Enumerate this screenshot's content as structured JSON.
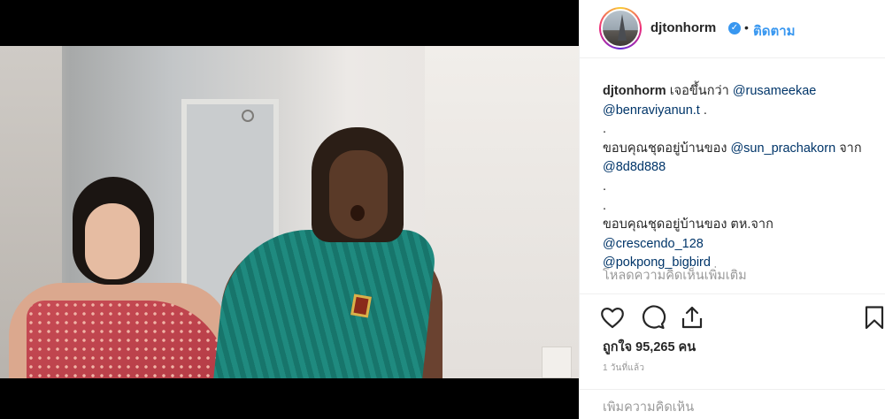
{
  "post": {
    "username": "djtonhorm",
    "verified_icon": "verified-badge-icon",
    "separator": "•",
    "follow_label": "ติดตาม",
    "caption": {
      "author": "djtonhorm",
      "intro": "เจอขึ้นกว่า",
      "mention_1": "@rusameekae",
      "mention_2": "@benraviyanun.t",
      "mention_2_trail": " .",
      "dot_1": ".",
      "thanks_1": "ขอบคุณชุดอยู่บ้านของ",
      "mention_3": "@sun_prachakorn",
      "from_1": "จาก",
      "mention_4": "@8d8d888",
      "dot_2": ".",
      "dot_3": ".",
      "thanks_2": "ขอบคุณชุดอยู่บ้านของ ตห.จาก",
      "mention_5": "@crescendo_128",
      "mention_6": "@pokpong_bigbird"
    },
    "load_more_label": "โหลดความคิดเห็นเพิ่มเติม",
    "likes_text": "ถูกใจ 95,265 คน",
    "timestamp": "1 วันที่แล้ว",
    "comment_placeholder": "เพิ่มความคิดเห็น"
  },
  "colors": {
    "link_blue": "#3897f0",
    "mention_dark_blue": "#003569",
    "muted_gray": "#999999"
  }
}
